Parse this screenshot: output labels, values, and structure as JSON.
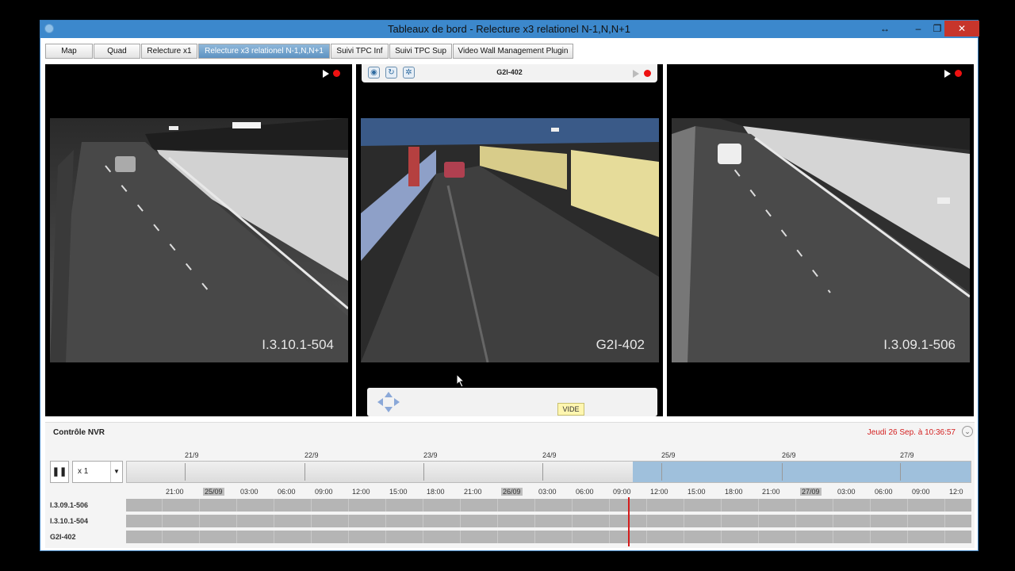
{
  "window": {
    "title": "Tableaux de bord - Relecture x3 relationel N-1,N,N+1",
    "controls": {
      "resize": "↔",
      "minimize": "–",
      "restore": "❐",
      "close": "✕"
    }
  },
  "tabs": [
    {
      "label": "Map"
    },
    {
      "label": "Quad"
    },
    {
      "label": "Relecture x1"
    },
    {
      "label": "Relecture x3 relationel N-1,N,N+1"
    },
    {
      "label": "Suivi TPC Inf"
    },
    {
      "label": "Suivi TPC Sup"
    },
    {
      "label": "Video Wall Management Plugin"
    }
  ],
  "active_tab_index": 3,
  "cameras": [
    {
      "label": "I.3.10.1-504"
    },
    {
      "label": "G2I-402",
      "toolbar_title": "G2I-402"
    },
    {
      "label": "I.3.09.1-506"
    }
  ],
  "tooltip": {
    "text": "VIDE"
  },
  "nvr": {
    "title": "Contrôle NVR",
    "datetime": "Jeudi 26 Sep. à 10:36:57",
    "speed": "x 1",
    "days": [
      "21/9",
      "22/9",
      "23/9",
      "24/9",
      "25/9",
      "26/9",
      "27/9"
    ],
    "hours": [
      "21:00",
      "25/09",
      "03:00",
      "06:00",
      "09:00",
      "12:00",
      "15:00",
      "18:00",
      "21:00",
      "26/09",
      "03:00",
      "06:00",
      "09:00",
      "12:00",
      "15:00",
      "18:00",
      "21:00",
      "27/09",
      "03:00",
      "06:00",
      "09:00",
      "12:0"
    ],
    "rows": [
      {
        "label": "I.3.09.1-506"
      },
      {
        "label": "I.3.10.1-504"
      },
      {
        "label": "G2I-402"
      }
    ]
  },
  "colors": {
    "titlebar": "#3c88cc",
    "active_tab": "#5d92c2",
    "recording": "#e11111",
    "cursor": "#d41c1c",
    "date_text": "#d42020"
  }
}
